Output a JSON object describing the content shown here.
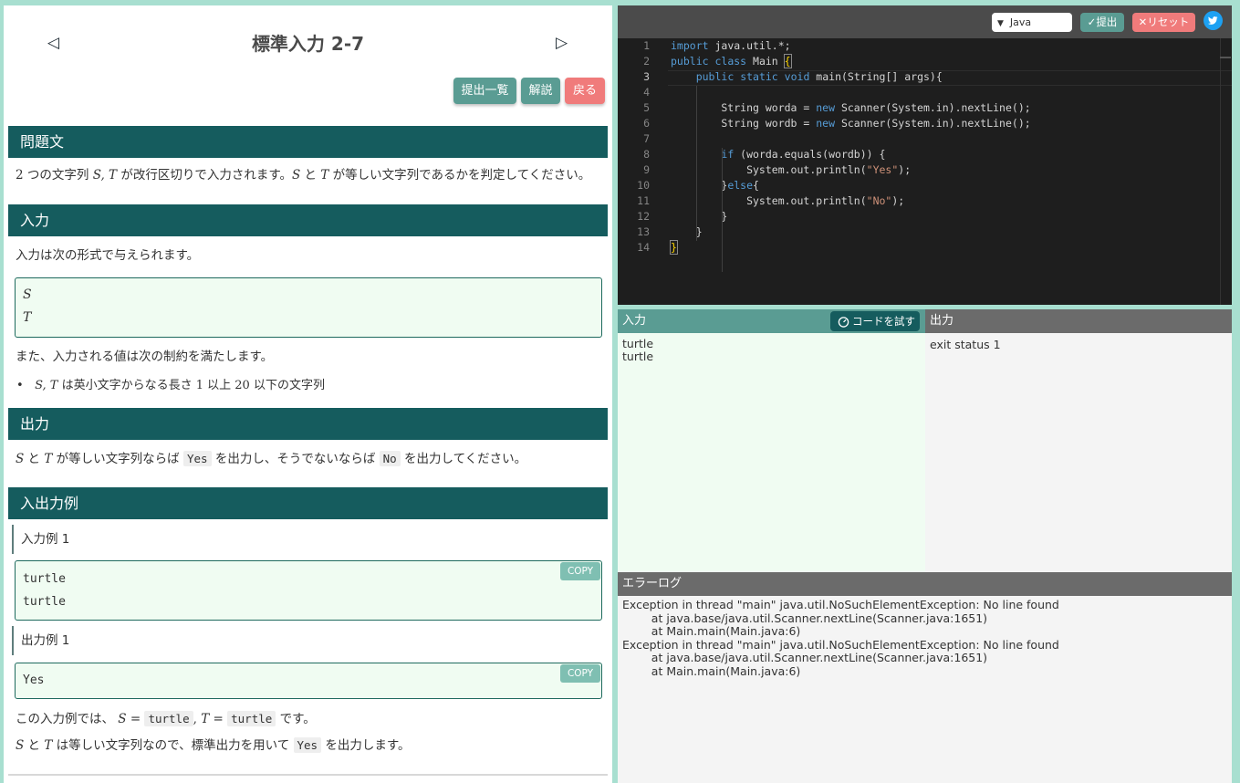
{
  "problem": {
    "title": "標準入力 2-7",
    "prev_icon": "triangle-left-icon",
    "next_icon": "triangle-right-icon",
    "buttons": {
      "submissions": "提出一覧",
      "explanation": "解説",
      "back": "戻る"
    },
    "statement": {
      "heading": "問題文",
      "n": "2",
      "t1": " つの文字列 ",
      "st": "S, T",
      "t2": " が改行区切りで入力されます。",
      "s": "S",
      "t3": " と ",
      "t": "T",
      "t4": " が等しい文字列であるかを判定してください。"
    },
    "input": {
      "heading": "入力",
      "intro": "入力は次の形式で与えられます。",
      "format": [
        "S",
        "T"
      ],
      "constraints_intro": "また、入力される値は次の制約を満たします。",
      "constraint": {
        "vars": "S, T",
        "t1": " は英小文字からなる長さ ",
        "n1": "1",
        "t2": " 以上 ",
        "n2": "20",
        "t3": " 以下の文字列"
      }
    },
    "output": {
      "heading": "出力",
      "s": "S",
      "t3": " と ",
      "t": "T",
      "t4": " が等しい文字列ならば ",
      "yes": "Yes",
      "t5": " を出力し、そうでないならば ",
      "no": "No",
      "t6": " を出力してください。"
    },
    "examples": {
      "heading": "入出力例",
      "input_label": "入力例 1",
      "input_lines": [
        "turtle",
        "turtle"
      ],
      "output_label": "出力例 1",
      "output_lines": [
        "Yes"
      ],
      "copy": "COPY",
      "note1": {
        "t1": "この入力例では、 ",
        "s": "S",
        "eq1": " = ",
        "v1": "turtle",
        "comma": ", ",
        "t": "T",
        "eq2": " = ",
        "v2": "turtle",
        "t2": " です。"
      },
      "note2": {
        "s": "S",
        "t1": " と ",
        "t": "T",
        "t2": " は等しい文字列なので、標準出力を用いて ",
        "yes": "Yes",
        "t3": " を出力します。"
      }
    }
  },
  "editor": {
    "language": "Java",
    "submit": "提出",
    "reset": "リセット",
    "active_line": 3,
    "lines": [
      [
        [
          "kw",
          "import"
        ],
        [
          "pl",
          " java.util.*;"
        ]
      ],
      [
        [
          "kw",
          "public"
        ],
        [
          "pl",
          " "
        ],
        [
          "kw",
          "class"
        ],
        [
          "pl",
          " Main "
        ],
        [
          "br",
          "{"
        ]
      ],
      [
        [
          "pl",
          "    "
        ],
        [
          "kw",
          "public"
        ],
        [
          "pl",
          " "
        ],
        [
          "kw",
          "static"
        ],
        [
          "pl",
          " "
        ],
        [
          "kw",
          "void"
        ],
        [
          "pl",
          " main(String[] args){"
        ]
      ],
      [
        [
          "pl",
          ""
        ]
      ],
      [
        [
          "pl",
          "        String worda = "
        ],
        [
          "kw",
          "new"
        ],
        [
          "pl",
          " Scanner(System.in).nextLine();"
        ]
      ],
      [
        [
          "pl",
          "        String wordb = "
        ],
        [
          "kw",
          "new"
        ],
        [
          "pl",
          " Scanner(System.in).nextLine();"
        ]
      ],
      [
        [
          "pl",
          ""
        ]
      ],
      [
        [
          "pl",
          "        "
        ],
        [
          "kw",
          "if"
        ],
        [
          "pl",
          " (worda.equals(wordb)) {"
        ]
      ],
      [
        [
          "pl",
          "            System.out.println("
        ],
        [
          "st",
          "\"Yes\""
        ],
        [
          "pl",
          ");"
        ]
      ],
      [
        [
          "pl",
          "        }"
        ],
        [
          "kw",
          "else"
        ],
        [
          "pl",
          "{"
        ]
      ],
      [
        [
          "pl",
          "            System.out.println("
        ],
        [
          "st",
          "\"No\""
        ],
        [
          "pl",
          ");"
        ]
      ],
      [
        [
          "pl",
          "        }"
        ]
      ],
      [
        [
          "pl",
          "    }"
        ]
      ],
      [
        [
          "br",
          "}"
        ]
      ]
    ]
  },
  "io": {
    "input_label": "入力",
    "try_button": "コードを試す",
    "input_text": "turtle\nturtle",
    "output_label": "出力",
    "output_text": "exit status 1",
    "error_label": "エラーログ",
    "error_text": "Exception in thread \"main\" java.util.NoSuchElementException: No line found\n\tat java.base/java.util.Scanner.nextLine(Scanner.java:1651)\n\tat Main.main(Main.java:6)\nException in thread \"main\" java.util.NoSuchElementException: No line found\n\tat java.base/java.util.Scanner.nextLine(Scanner.java:1651)\n\tat Main.main(Main.java:6)"
  },
  "colors": {
    "background": "#a8dfd0",
    "section_header": "#155c5e",
    "teal_button": "#5a9c93",
    "red_button": "#f07b7b",
    "editor_bg": "#1e1e1e",
    "keyword": "#569cd6",
    "string": "#ce9178",
    "bracket": "#ffd700"
  }
}
